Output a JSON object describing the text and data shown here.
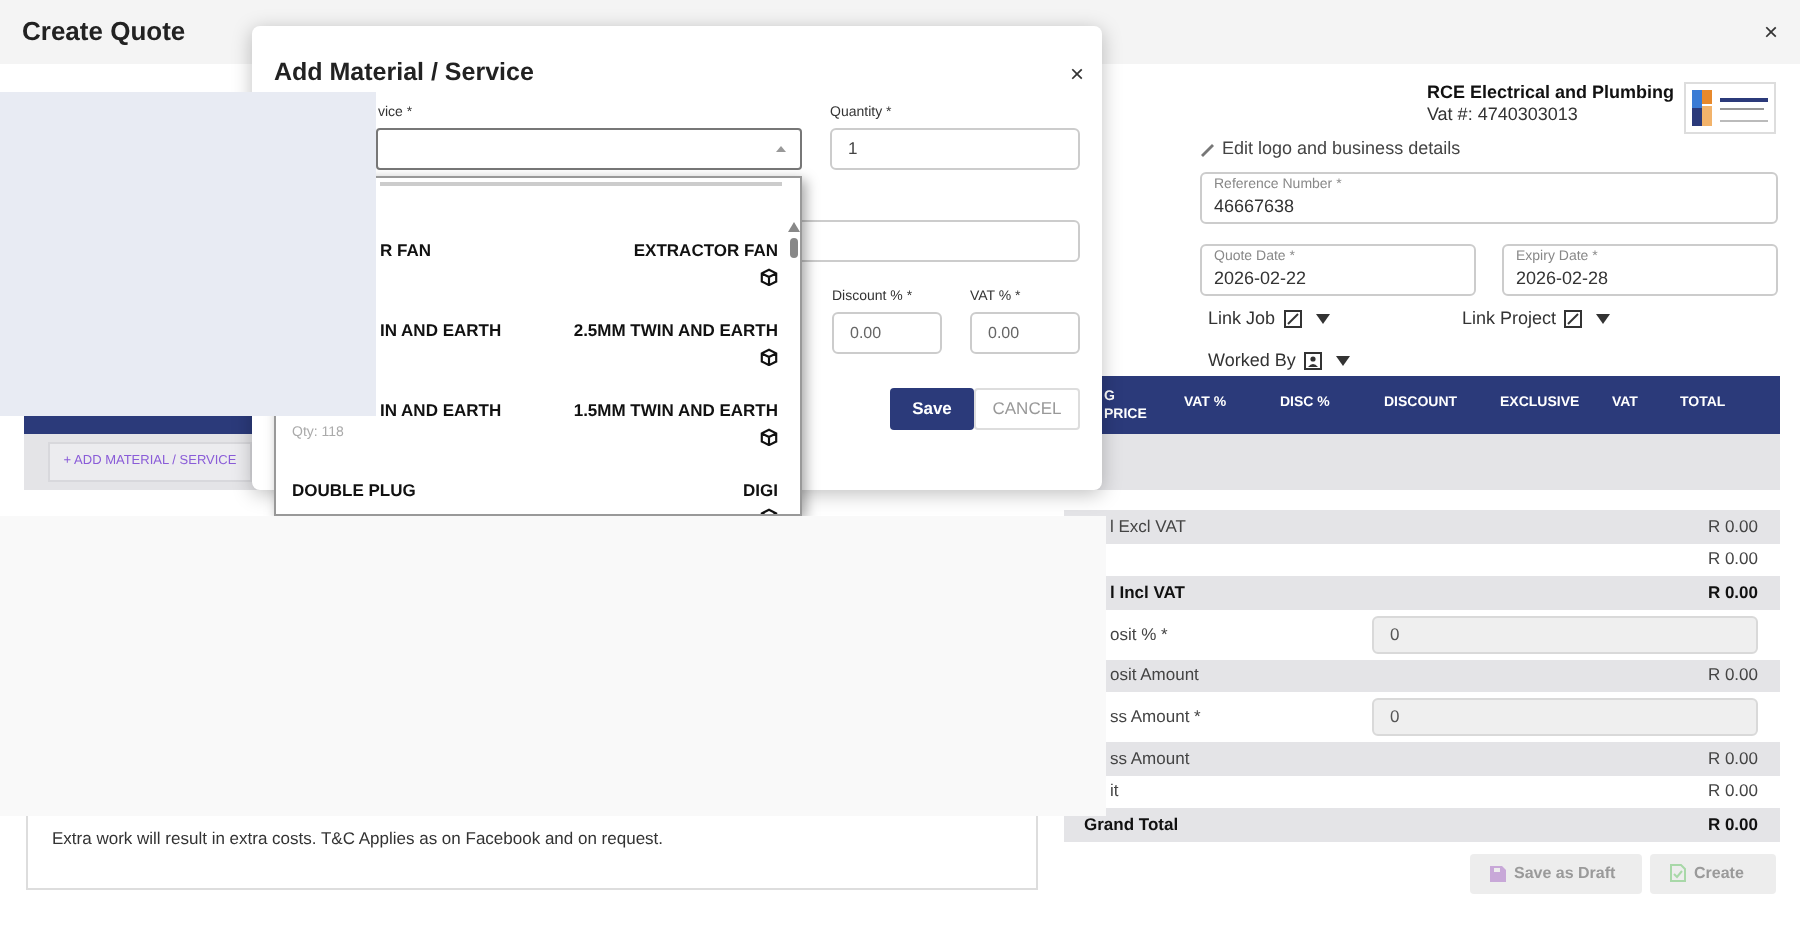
{
  "page": {
    "title": "Create Quote",
    "close": "×"
  },
  "business": {
    "name": "RCE Electrical and Plumbing",
    "vat": "Vat #: 4740303013",
    "edit_link": "Edit logo and business details"
  },
  "fields": [
    {
      "label": "Reference Number *",
      "value": "46667638",
      "kind": "wide"
    },
    {
      "label": "Quote Date *",
      "value": "2026-02-22",
      "kind": "half"
    },
    {
      "label": "Expiry Date *",
      "value": "2026-02-28",
      "kind": "half"
    }
  ],
  "links": [
    {
      "label": "Link Job",
      "kind": "edit"
    },
    {
      "label": "Link Project",
      "kind": "edit"
    },
    {
      "label": "Worked By",
      "kind": "person"
    }
  ],
  "table": {
    "columns": [
      "G PRICE",
      "VAT %",
      "DISC %",
      "DISCOUNT",
      "EXCLUSIVE",
      "VAT",
      "TOTAL"
    ],
    "add_button": "+ ADD MATERIAL / SERVICE"
  },
  "summary": [
    {
      "kind": "amount",
      "label": "l Excl VAT",
      "value": "R 0.00",
      "shaded": true,
      "bold": false,
      "label_cut": true
    },
    {
      "kind": "amount",
      "value": "R 0.00",
      "shaded": false,
      "bold": false
    },
    {
      "kind": "amount",
      "label": "l Incl VAT",
      "value": "R 0.00",
      "shaded": true,
      "bold": true,
      "label_cut": true
    },
    {
      "kind": "input",
      "label": "osit % *",
      "value": "0",
      "shaded": false,
      "bold": false,
      "label_cut": true
    },
    {
      "kind": "amount",
      "label": "osit Amount",
      "value": "R 0.00",
      "shaded": true,
      "bold": false,
      "label_cut": true
    },
    {
      "kind": "input",
      "label": "ss Amount *",
      "value": "0",
      "shaded": false,
      "bold": false,
      "label_cut": true
    },
    {
      "kind": "amount",
      "label": "ss Amount",
      "value": "R 0.00",
      "shaded": true,
      "bold": false,
      "label_cut": true
    },
    {
      "kind": "amount",
      "label": "it",
      "value": "R 0.00",
      "shaded": false,
      "bold": false,
      "label_cut": true
    },
    {
      "kind": "amount",
      "label": "Grand Total",
      "value": "R 0.00",
      "shaded": true,
      "bold": true,
      "label_cut": false
    }
  ],
  "notes": "Extra work will result in extra costs. T&C Applies as on Facebook and on request.",
  "actions": [
    {
      "label": "Save as Draft",
      "kind": "draft",
      "disabled": true
    },
    {
      "label": "Create",
      "kind": "create",
      "disabled": true
    }
  ],
  "modal": {
    "title": "Add Material / Service",
    "close": "×",
    "item_label": "vice *",
    "quantity": {
      "label": "Quantity *",
      "value": "1"
    },
    "discount": {
      "label": "Discount % *",
      "value": "0.00"
    },
    "vat": {
      "label": "VAT % *",
      "value": "0.00"
    },
    "buttons": [
      {
        "label": "Save",
        "kind": "primary"
      },
      {
        "label": "CANCEL",
        "kind": "secondary"
      }
    ],
    "dropdown": {
      "items": [
        {
          "name": "R FAN",
          "category": "EXTRACTOR FAN",
          "name_cut": true
        },
        {
          "name": "IN AND EARTH",
          "category": "2.5MM TWIN AND EARTH",
          "name_cut": true
        },
        {
          "name": "IN AND EARTH",
          "qty": "Qty: 118",
          "category": "1.5MM TWIN AND EARTH",
          "name_cut": true
        },
        {
          "name": "DOUBLE PLUG",
          "category": "DIGI",
          "name_cut": false
        }
      ]
    }
  }
}
